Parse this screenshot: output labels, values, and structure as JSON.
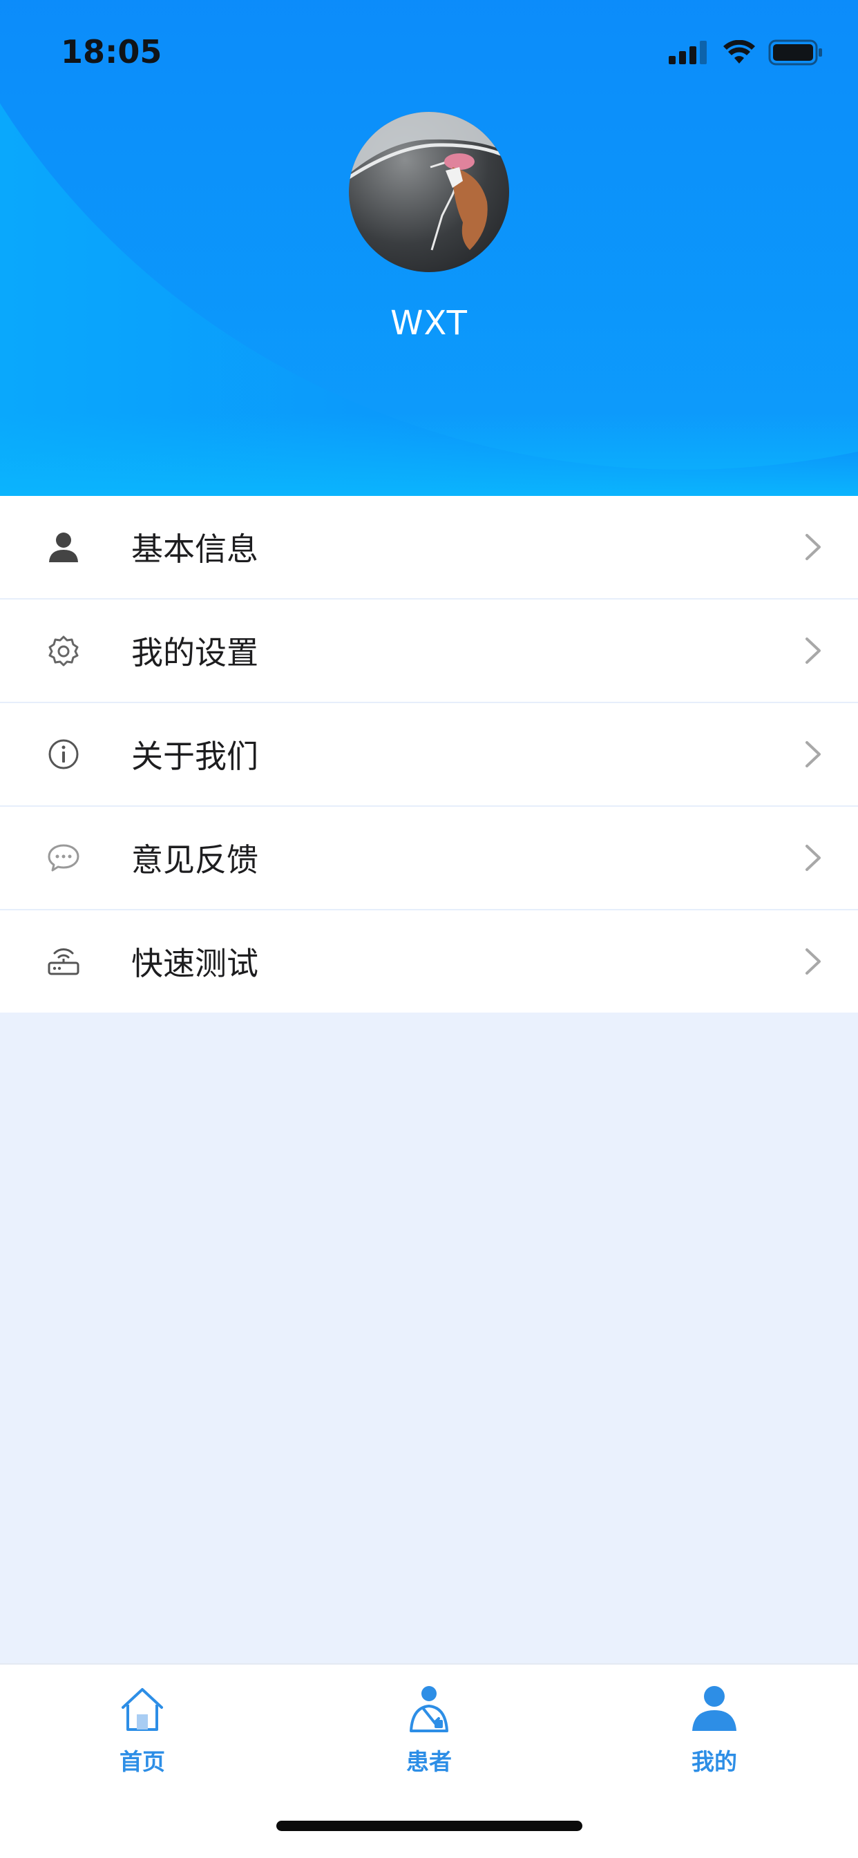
{
  "status_bar": {
    "time": "18:05",
    "icons": [
      "signal-icon",
      "wifi-icon",
      "battery-icon"
    ]
  },
  "profile": {
    "username": "WXT"
  },
  "menu": {
    "items": [
      {
        "label": "基本信息",
        "icon": "user-icon"
      },
      {
        "label": "我的设置",
        "icon": "gear-icon"
      },
      {
        "label": "关于我们",
        "icon": "info-icon"
      },
      {
        "label": "意见反馈",
        "icon": "chat-bubble-icon"
      },
      {
        "label": "快速测试",
        "icon": "router-icon"
      }
    ]
  },
  "tabbar": {
    "tabs": [
      {
        "label": "首页",
        "icon": "home-icon"
      },
      {
        "label": "患者",
        "icon": "patient-icon"
      },
      {
        "label": "我的",
        "icon": "profile-icon"
      }
    ],
    "active_color": "#2d8ee6"
  },
  "colors": {
    "header_gradient_start": "#0aa8fc",
    "header_gradient_end": "#0767f3",
    "page_background": "#eaf1fd",
    "accent": "#2d8ee6"
  }
}
